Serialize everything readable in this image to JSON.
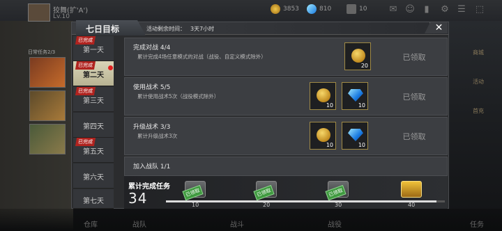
{
  "topbar": {
    "player_name": "狡舞(扩'A')",
    "player_level": "Lv.10",
    "gold": "3853",
    "diamond": "810",
    "tickets": "10"
  },
  "left": {
    "progress_text": "日常任务2/3"
  },
  "right": {
    "items": [
      "商城",
      "活动",
      "首充"
    ]
  },
  "bottom": {
    "labels": [
      "仓库",
      "战队",
      "战斗",
      "战役",
      "任务"
    ]
  },
  "dialog": {
    "title": "七日目标",
    "remaining_label": "活动剩余时间：",
    "remaining_value": "3天7小时",
    "close_icon": "close-icon",
    "days": [
      {
        "label": "第一天",
        "badge": "已完成"
      },
      {
        "label": "第二天",
        "badge": "已完成"
      },
      {
        "label": "第三天",
        "badge": "已完成"
      },
      {
        "label": "第四天",
        "badge": ""
      },
      {
        "label": "第五天",
        "badge": "已完成"
      },
      {
        "label": "第六天",
        "badge": ""
      },
      {
        "label": "第七天",
        "badge": ""
      }
    ],
    "tasks": [
      {
        "title": "完成对战",
        "progress": "4/4",
        "desc": "累计完成4场任意模式的对战（战役、自定义模式除外）",
        "rewards": [
          {
            "icon": "gold-coin-icon",
            "qty": "20"
          }
        ],
        "status": "已领取"
      },
      {
        "title": "使用战术",
        "progress": "5/5",
        "desc": "累计使用战术5次（战役模式除外）",
        "rewards": [
          {
            "icon": "gold-coin-icon",
            "qty": "10"
          },
          {
            "icon": "diamond-icon",
            "qty": "10"
          }
        ],
        "status": "已领取"
      },
      {
        "title": "升级战术",
        "progress": "3/3",
        "desc": "累计升级战术3次",
        "rewards": [
          {
            "icon": "gold-coin-icon",
            "qty": "10"
          },
          {
            "icon": "diamond-icon",
            "qty": "10"
          }
        ],
        "status": "已领取"
      },
      {
        "title": "加入战队",
        "progress": "1/1",
        "desc": "",
        "rewards": [],
        "status": ""
      }
    ],
    "progress": {
      "label": "累计完成任务",
      "value": "34",
      "fill_fraction": 0.97,
      "chests": [
        {
          "value": "10",
          "stamp": "已领取",
          "type": "silver"
        },
        {
          "value": "20",
          "stamp": "已领取",
          "type": "silver"
        },
        {
          "value": "30",
          "stamp": "已领取",
          "type": "silver"
        },
        {
          "value": "40",
          "stamp": "",
          "type": "gold"
        }
      ]
    }
  }
}
